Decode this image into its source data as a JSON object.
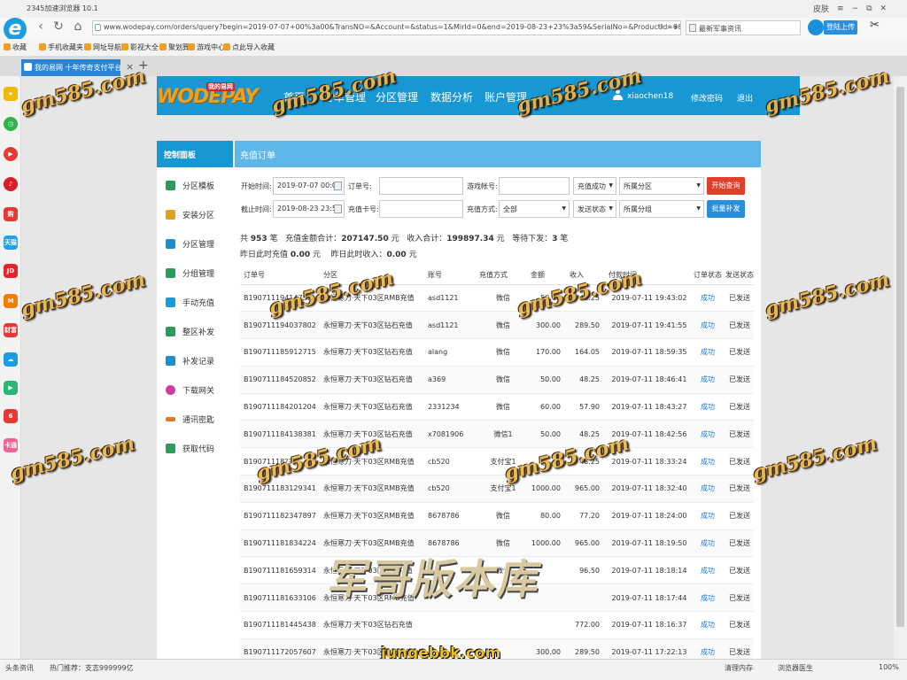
{
  "browser": {
    "title": "2345加速浏览器 10.1",
    "window_controls": {
      "skin": "皮肤",
      "menu": "≡",
      "minimize": "−",
      "restore": "⧉",
      "close": "✕"
    },
    "url": "www.wodepay.com/orders/query?begin=2019-07-07+00%3a00&TransNO=&Account=&status=1&MirId=0&end=2019-08-23+23%3a59&SerialNo=&ProductId=0&Sent=&",
    "news_placeholder": "最新军事资讯",
    "login_label": "登陆上传",
    "bookmarks": [
      "收藏",
      "手机收藏夹",
      "网址导航",
      "影视大全",
      "聚划算",
      "游戏中心",
      "点此导入收藏"
    ],
    "tab_title": "我的易网 十年传奇支付平台",
    "status": {
      "left1": "头条资讯",
      "left2": "热门推荐：支志999999亿",
      "memory": "清理内存",
      "doctor": "浏览器医生",
      "zoom": "100%"
    }
  },
  "side_rail_icons": [
    "star-icon",
    "clock-icon",
    "play-icon",
    "music-icon",
    "shop-icon",
    "tmall-icon",
    "jd-icon",
    "mi-icon",
    "finance-icon",
    "cloud-icon",
    "video-icon",
    "game6-icon",
    "travel-icon"
  ],
  "rail_labels": {
    "shop": "购",
    "tmall": "天猫",
    "jd": "JD",
    "finance": "财富",
    "game6": "6",
    "travel": "卡通"
  },
  "site": {
    "logo": "WODEPAY",
    "logo_badge": "我的易网",
    "nav": [
      "首页",
      "订单管理",
      "分区管理",
      "数据分析",
      "账户管理"
    ],
    "username": "xiaochen18",
    "change_password": "修改密码",
    "logout": "退出"
  },
  "sidebar": {
    "title": "控制面板",
    "items": [
      {
        "label": "分区模板",
        "icon": "template-icon",
        "color": "#2a9d5c"
      },
      {
        "label": "安装分区",
        "icon": "wrench-icon",
        "color": "#e0a020"
      },
      {
        "label": "分区管理",
        "icon": "server-icon",
        "color": "#1a8fd0"
      },
      {
        "label": "分组管理",
        "icon": "group-icon",
        "color": "#2a9d5c"
      },
      {
        "label": "手动充值",
        "icon": "send-icon",
        "color": "#1a9ad8"
      },
      {
        "label": "整区补发",
        "icon": "box-icon",
        "color": "#2a9d5c"
      },
      {
        "label": "补发记录",
        "icon": "record-icon",
        "color": "#1a8fd0"
      },
      {
        "label": "下载网关",
        "icon": "download-icon",
        "color": "#d03aa0"
      },
      {
        "label": "通讯密匙",
        "icon": "key-icon",
        "color": "#e07a20"
      },
      {
        "label": "获取代码",
        "icon": "code-icon",
        "color": "#2a9d5c"
      }
    ]
  },
  "panel": {
    "title": "充值订单",
    "filters": {
      "start_label": "开始时间:",
      "start_value": "2019-07-07 00:00",
      "end_label": "截止时间:",
      "end_value": "2019-08-23 23:59",
      "order_label": "订单号:",
      "card_label": "充值卡号:",
      "account_label": "游戏帐号:",
      "method_label": "充值方式:",
      "method_value": "全部",
      "status_value": "充值成功",
      "send_value": "发送状态",
      "zone_value": "所属分区",
      "group_value": "所属分组",
      "query_button": "开始查询",
      "batch_button": "批量补发"
    },
    "summary": {
      "total_prefix": "共",
      "total_count": "953",
      "total_unit": "笔",
      "amount_label": "充值金额合计：",
      "amount_value": "207147.50",
      "amount_unit": "元",
      "income_label": "收入合计：",
      "income_value": "199897.34",
      "income_unit": "元",
      "pending_label": "等待下发：",
      "pending_value": "3",
      "pending_unit": "笔",
      "yesterday_recharge_label": "昨日此时充值",
      "yesterday_recharge_value": "0.00",
      "yesterday_recharge_unit": "元",
      "yesterday_income_label": "昨日此时收入：",
      "yesterday_income_value": "0.00",
      "yesterday_income_unit": "元"
    },
    "columns": [
      "订单号",
      "分区",
      "账号",
      "充值方式",
      "金额",
      "收入",
      "付款时间",
      "订单状态",
      "发送状态"
    ],
    "rows": [
      [
        "B1907111941475??",
        "永恒寒刀·天下03区RMB充值",
        "asd1121",
        "微信",
        "50.00",
        "48.25",
        "2019-07-11 19:43:02",
        "成功",
        "已发送"
      ],
      [
        "B190711194037802",
        "永恒寒刀·天下03区钻石充值",
        "asd1121",
        "微信",
        "300.00",
        "289.50",
        "2019-07-11 19:41:55",
        "成功",
        "已发送"
      ],
      [
        "B190711185912715",
        "永恒寒刀·天下03区钻石充值",
        "alang",
        "微信",
        "170.00",
        "164.05",
        "2019-07-11 18:59:35",
        "成功",
        "已发送"
      ],
      [
        "B190711184520852",
        "永恒寒刀·天下03区钻石充值",
        "a369",
        "微信",
        "50.00",
        "48.25",
        "2019-07-11 18:46:41",
        "成功",
        "已发送"
      ],
      [
        "B190711184201204",
        "永恒寒刀·天下03区钻石充值",
        "2331234",
        "微信",
        "60.00",
        "57.90",
        "2019-07-11 18:43:27",
        "成功",
        "已发送"
      ],
      [
        "B190711184138381",
        "永恒寒刀·天下03区钻石充值",
        "x7081906",
        "微信1",
        "50.00",
        "48.25",
        "2019-07-11 18:42:56",
        "成功",
        "已发送"
      ],
      [
        "B19071118??",
        "永恒寒刀·天下03区RMB充值",
        "cb520",
        "支付宝1",
        "",
        "48.25",
        "2019-07-11 18:33:24",
        "成功",
        "已发送"
      ],
      [
        "B190711183129341",
        "永恒寒刀·天下03区RMB充值",
        "cb520",
        "支付宝1",
        "1000.00",
        "965.00",
        "2019-07-11 18:32:40",
        "成功",
        "已发送"
      ],
      [
        "B190711182347897",
        "永恒寒刀·天下03区RMB充值",
        "8678786",
        "微信",
        "80.00",
        "77.20",
        "2019-07-11 18:24:00",
        "成功",
        "已发送"
      ],
      [
        "B190711181834224",
        "永恒寒刀·天下03区RMB充值",
        "8678786",
        "微信",
        "1000.00",
        "965.00",
        "2019-07-11 18:19:50",
        "成功",
        "已发送"
      ],
      [
        "B190711181659314",
        "永恒寒刀·天下03区钻石充值",
        "",
        "微信",
        "",
        "96.50",
        "2019-07-11 18:18:14",
        "成功",
        "已发送"
      ],
      [
        "B190711181633106",
        "永恒寒刀·天下03区RMB充值",
        "",
        "",
        "",
        "",
        "2019-07-11 18:17:44",
        "成功",
        "已发送"
      ],
      [
        "B190711181445438",
        "永恒寒刀·天下03区钻石充值",
        "",
        "",
        "",
        "772.00",
        "2019-07-11 18:16:37",
        "成功",
        "已发送"
      ],
      [
        "B190711172057607",
        "永恒寒刀·天下03区钻石充值",
        "",
        "",
        "300.00",
        "289.50",
        "2019-07-11 17:22:13",
        "成功",
        "已发送"
      ]
    ]
  },
  "watermarks": {
    "site": "gm585.com",
    "calligraphy": "军哥版本库",
    "url": "jungebbk.com"
  }
}
